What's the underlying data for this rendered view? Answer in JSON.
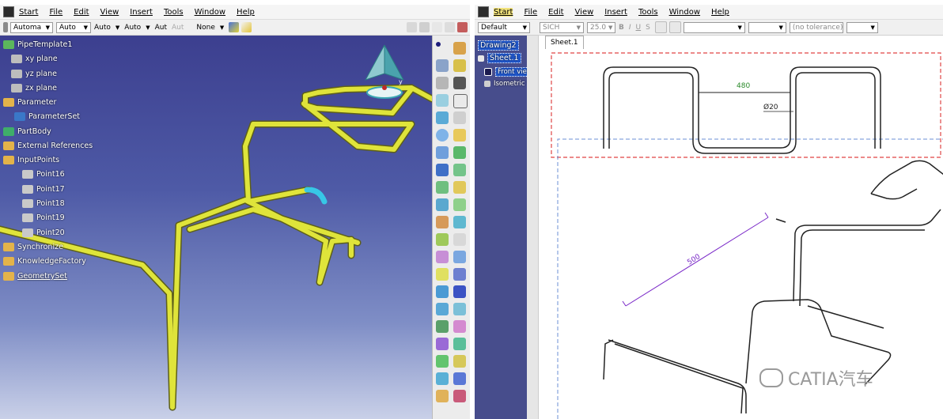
{
  "left_window": {
    "menu": [
      "Start",
      "File",
      "Edit",
      "View",
      "Insert",
      "Tools",
      "Window",
      "Help"
    ],
    "toolbar": {
      "combo1": "Automa",
      "combo2": "Auto",
      "label3": "Auto",
      "label4": "Auto",
      "label5": "Aut",
      "label6": "Aut",
      "label7": "None"
    },
    "tree": [
      {
        "label": "PipeTemplate1"
      },
      {
        "label": "xy plane"
      },
      {
        "label": "yz plane"
      },
      {
        "label": "zx plane"
      },
      {
        "label": "Parameter"
      },
      {
        "label": "ParameterSet"
      },
      {
        "label": "PartBody"
      },
      {
        "label": "External References"
      },
      {
        "label": "InputPoints"
      },
      {
        "label": "Point16"
      },
      {
        "label": "Point17"
      },
      {
        "label": "Point18"
      },
      {
        "label": "Point19"
      },
      {
        "label": "Point20"
      },
      {
        "label": "Synchronize"
      },
      {
        "label": "KnowledgeFactory"
      },
      {
        "label": "GeometrySet"
      }
    ],
    "compass_axis_label": "y"
  },
  "right_window": {
    "menu": [
      "Start",
      "File",
      "Edit",
      "View",
      "Insert",
      "Tools",
      "Window",
      "Help"
    ],
    "toolbar": {
      "style_combo": "Default",
      "font_combo": "SICH",
      "size_combo": "25.0",
      "tolerance_combo": "(no tolerance)"
    },
    "tree": [
      {
        "label": "Drawing2"
      },
      {
        "label": "Sheet.1"
      },
      {
        "label": "Front view"
      },
      {
        "label": "Isometric v"
      }
    ],
    "sheet_tab": "Sheet.1",
    "dimensions": {
      "front_length": "480",
      "front_diameter": "Ø20",
      "iso_length": "500"
    }
  },
  "watermark": "CATIA汽车",
  "colors": {
    "viewport_top": "#3c3f8f",
    "pipe": "#dfe43a",
    "pipe_selected": "#37c7e6",
    "front_frame": "#e04545",
    "iso_frame": "#6b8fd6",
    "dim_line": "#7a29c8",
    "tree_bg_drawing": "#474d8c"
  }
}
